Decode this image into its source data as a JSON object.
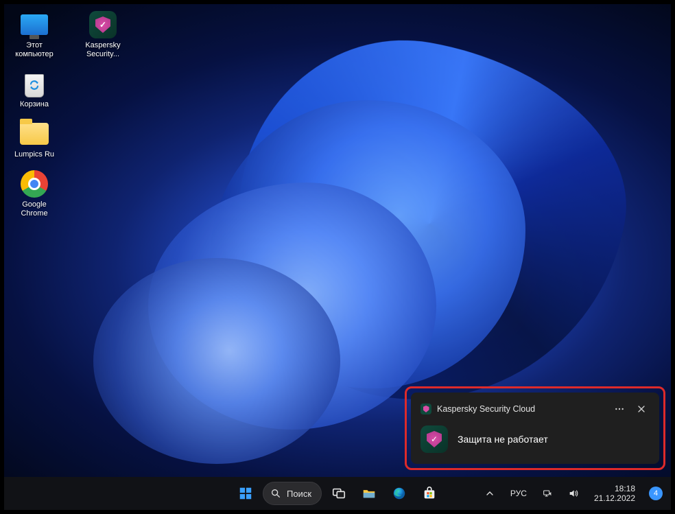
{
  "desktop_icons": {
    "this_pc": "Этот\nкомпьютер",
    "kaspersky": "Kaspersky\nSecurity...",
    "recycle_bin": "Корзина",
    "folder_lumpics": "Lumpics Ru",
    "chrome": "Google\nChrome"
  },
  "notification": {
    "app_name": "Kaspersky Security Cloud",
    "message": "Защита не работает"
  },
  "taskbar": {
    "search_label": "Поиск",
    "language": "РУС",
    "time": "18:18",
    "date": "21.12.2022",
    "notification_count": "4"
  }
}
